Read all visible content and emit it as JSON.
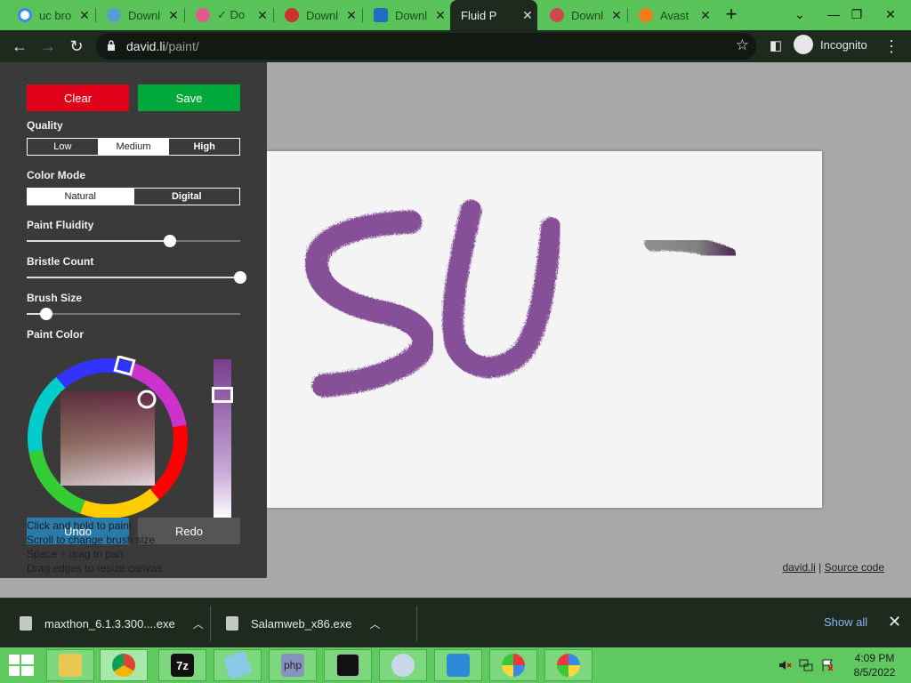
{
  "browser": {
    "tabs": [
      {
        "title": "uc bro",
        "color": "#4285f4"
      },
      {
        "title": "Downl",
        "color": "#5a9bd4"
      },
      {
        "title": "✓ Do",
        "color": "#e05a8a"
      },
      {
        "title": "Downl",
        "color": "#c8342a"
      },
      {
        "title": "Downl",
        "color": "#1e6fbf"
      },
      {
        "title": "Fluid P",
        "color": "#ffffff"
      },
      {
        "title": "Downl",
        "color": "#c84a4a"
      },
      {
        "title": "Avast",
        "color": "#f07d1a"
      }
    ],
    "url_host": "david.li",
    "url_path": "/paint/",
    "incognito_label": "Incognito"
  },
  "panel": {
    "clear_label": "Clear",
    "save_label": "Save",
    "quality_label": "Quality",
    "quality_options": [
      "Low",
      "Medium",
      "High"
    ],
    "quality_selected": "Medium",
    "color_mode_label": "Color Mode",
    "color_mode_options": [
      "Natural",
      "Digital"
    ],
    "color_mode_selected": "Natural",
    "fluidity_label": "Paint Fluidity",
    "fluidity_value": 0.67,
    "bristle_label": "Bristle Count",
    "bristle_value": 1.0,
    "brush_label": "Brush Size",
    "brush_value": 0.09,
    "paint_color_label": "Paint Color",
    "undo_label": "Undo",
    "redo_label": "Redo",
    "hints": [
      "Click and hold to paint",
      "Scroll to change brush size",
      "Space + drag to pan",
      "Drag edges to resize canvas"
    ]
  },
  "footer": {
    "author_link": "david.li",
    "divider": "|",
    "source_link": "Source code"
  },
  "downloads": {
    "items": [
      {
        "name": "maxthon_6.1.3.300....exe"
      },
      {
        "name": "Salamweb_x86.exe"
      }
    ],
    "show_all": "Show all"
  },
  "taskbar": {
    "time": "4:09 PM",
    "date": "8/5/2022"
  },
  "colors": {
    "clear": "#e0001a",
    "save": "#00a83a",
    "paint_purple": "#7a3d8f"
  }
}
